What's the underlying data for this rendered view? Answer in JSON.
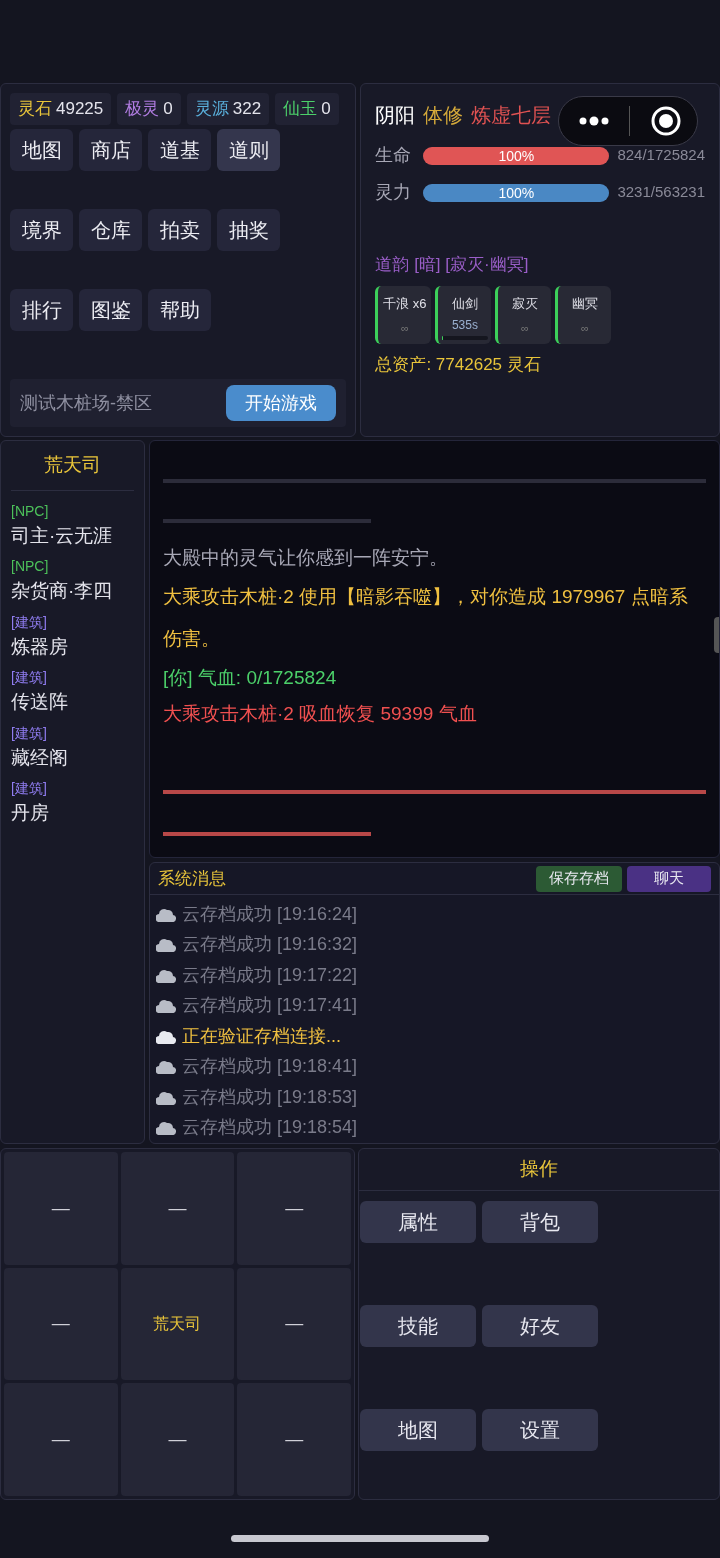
{
  "currencies": [
    {
      "label": "灵石",
      "value": "49225",
      "color": "#e8c43a"
    },
    {
      "label": "极灵",
      "value": "0",
      "color": "#b07ce0"
    },
    {
      "label": "灵源",
      "value": "322",
      "color": "#5ab0dc"
    },
    {
      "label": "仙玉",
      "value": "0",
      "color": "#4cd06a"
    }
  ],
  "nav_rows": [
    [
      {
        "label": "地图",
        "selected": false
      },
      {
        "label": "商店",
        "selected": false
      },
      {
        "label": "道基",
        "selected": false
      },
      {
        "label": "道则",
        "selected": true
      }
    ],
    [
      {
        "label": "境界",
        "selected": false
      },
      {
        "label": "仓库",
        "selected": false
      },
      {
        "label": "拍卖",
        "selected": false
      },
      {
        "label": "抽奖",
        "selected": false
      }
    ],
    [
      {
        "label": "排行",
        "selected": false
      },
      {
        "label": "图鉴",
        "selected": false
      },
      {
        "label": "帮助",
        "selected": false
      }
    ]
  ],
  "location": "测试木桩场-禁区",
  "start_button": "开始游戏",
  "player": {
    "name": "阴阳",
    "path": "体修",
    "realm": "炼虚七层",
    "bars": [
      {
        "label": "生命",
        "kind": "hp",
        "level": 1,
        "percent": "100%",
        "reading": "824/1725824"
      },
      {
        "label": "灵力",
        "kind": "mp",
        "level": 1,
        "percent": "100%",
        "reading": "3231/563231"
      }
    ],
    "dao_yun": "道韵 [暗] [寂灭·幽冥]",
    "buffs": [
      {
        "name": "千浪 x6",
        "duration": "∞",
        "kind": "permanent"
      },
      {
        "name": "仙剑",
        "duration": "535s",
        "kind": "timed",
        "level": 0.03
      },
      {
        "name": "寂灭",
        "duration": "∞",
        "kind": "permanent"
      },
      {
        "name": "幽冥",
        "duration": "∞",
        "kind": "permanent"
      }
    ],
    "total_assets": "总资产: 7742625 灵石"
  },
  "sidebar": {
    "title": "荒天司",
    "items": [
      {
        "tag": "[NPC]",
        "name": "司主·云无涯",
        "kind": "npc"
      },
      {
        "tag": "[NPC]",
        "name": "杂货商·李四",
        "kind": "npc"
      },
      {
        "tag": "[建筑]",
        "name": "炼器房",
        "kind": "building"
      },
      {
        "tag": "[建筑]",
        "name": "传送阵",
        "kind": "building"
      },
      {
        "tag": "[建筑]",
        "name": "藏经阁",
        "kind": "building"
      },
      {
        "tag": "[建筑]",
        "name": "丹房",
        "kind": "building"
      }
    ]
  },
  "log": [
    {
      "kind": "divider_long"
    },
    {
      "kind": "divider_short"
    },
    {
      "kind": "normal",
      "text": "大殿中的灵气让你感到一阵安宁。"
    },
    {
      "kind": "attack",
      "text": "大乘攻击木桩·2 使用【暗影吞噬】，对你造成 1979967 点暗系伤害。"
    },
    {
      "kind": "self",
      "text": "[你] 气血: 0/1725824"
    },
    {
      "kind": "enemy",
      "text": "大乘攻击木桩·2 吸血恢复 59399 气血"
    },
    {
      "kind": "danger_long"
    },
    {
      "kind": "danger_short"
    }
  ],
  "system": {
    "title": "系统消息",
    "buttons": [
      {
        "label": "保存存档",
        "kind": "save"
      },
      {
        "label": "聊天",
        "kind": "chat"
      }
    ],
    "messages": [
      {
        "text": "云存档成功 [19:16:24]",
        "kind": "done"
      },
      {
        "text": "云存档成功 [19:16:32]",
        "kind": "done"
      },
      {
        "text": "云存档成功 [19:17:22]",
        "kind": "done"
      },
      {
        "text": "云存档成功 [19:17:41]",
        "kind": "done"
      },
      {
        "text": "正在验证存档连接...",
        "kind": "pending"
      },
      {
        "text": "云存档成功 [19:18:41]",
        "kind": "done"
      },
      {
        "text": "云存档成功 [19:18:53]",
        "kind": "done"
      },
      {
        "text": "云存档成功 [19:18:54]",
        "kind": "done"
      }
    ]
  },
  "map_grid": [
    {
      "label": "—",
      "current": false
    },
    {
      "label": "—",
      "current": false
    },
    {
      "label": "—",
      "current": false
    },
    {
      "label": "—",
      "current": false
    },
    {
      "label": "荒天司",
      "current": true
    },
    {
      "label": "—",
      "current": false
    },
    {
      "label": "—",
      "current": false
    },
    {
      "label": "—",
      "current": false
    },
    {
      "label": "—",
      "current": false
    }
  ],
  "actions": {
    "title": "操作",
    "buttons": [
      "属性",
      "背包",
      "技能",
      "好友",
      "地图",
      "设置"
    ]
  }
}
